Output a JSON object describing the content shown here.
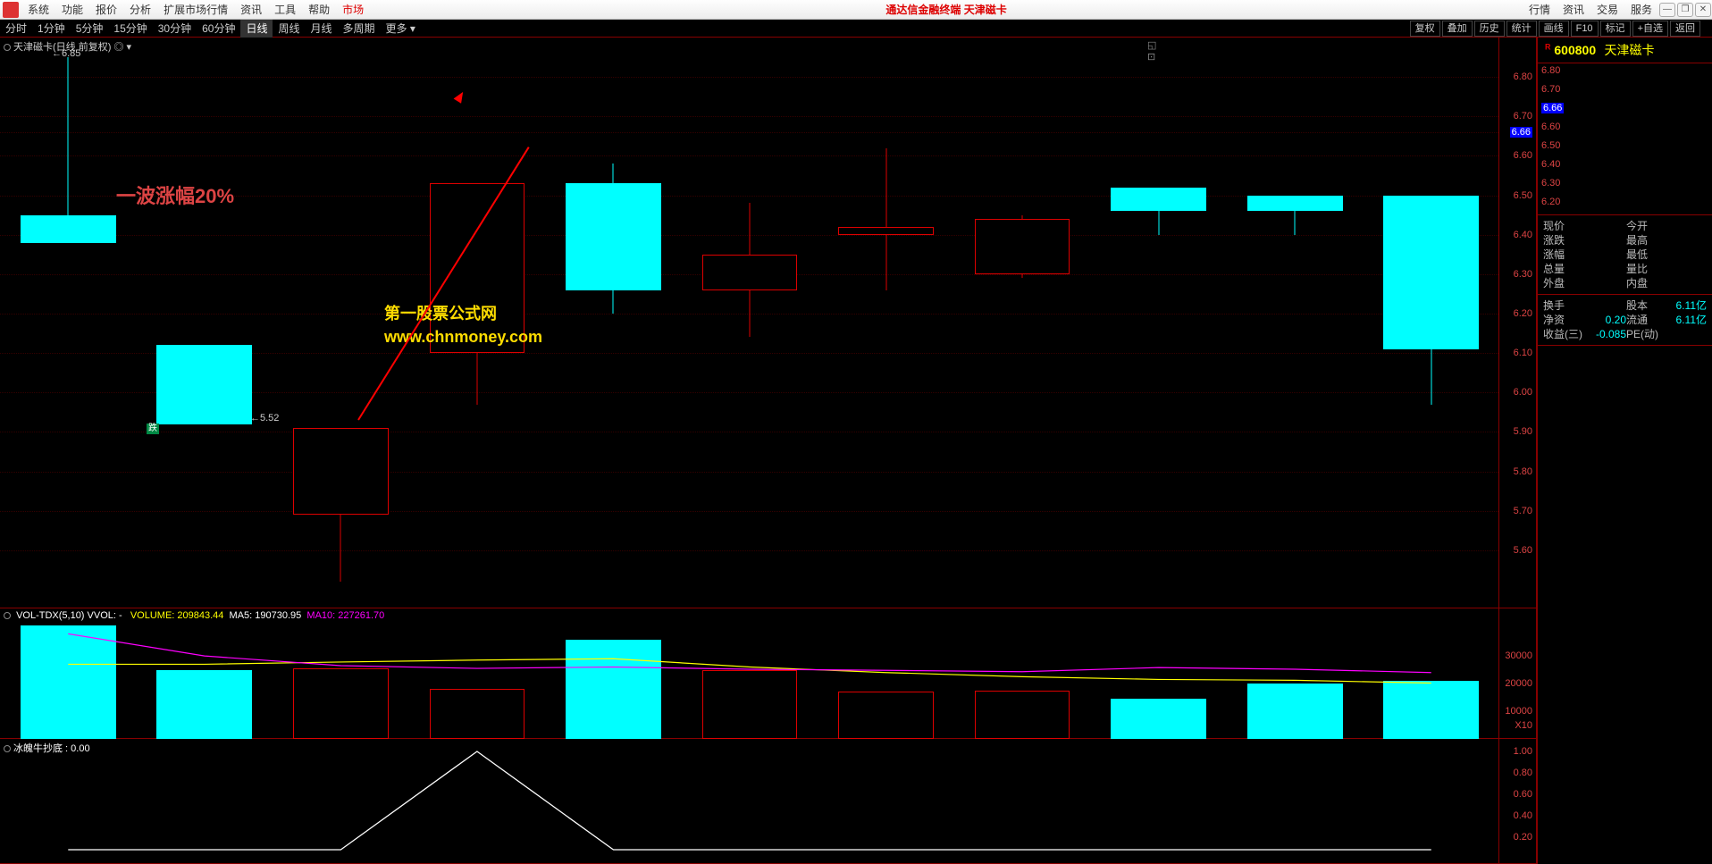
{
  "app": {
    "title_center": "通达信金融终端  天津磁卡"
  },
  "menubar": {
    "items": [
      "系统",
      "功能",
      "报价",
      "分析",
      "扩展市场行情",
      "资讯",
      "工具",
      "帮助"
    ],
    "market": "市场",
    "right": [
      "行情",
      "资讯",
      "交易",
      "服务"
    ]
  },
  "timebar": {
    "frames": [
      "分时",
      "1分钟",
      "5分钟",
      "15分钟",
      "30分钟",
      "60分钟",
      "日线",
      "周线",
      "月线",
      "多周期",
      "更多 ▾"
    ],
    "active": 6,
    "tools": [
      "复权",
      "叠加",
      "历史",
      "统计",
      "画线",
      "F10",
      "标记",
      "+自选",
      "返回"
    ]
  },
  "stock": {
    "code": "600800",
    "name": "天津磁卡",
    "sup": "R"
  },
  "candle_header": "天津磁卡(日线 前复权) ◎ ▾",
  "price_yaxis": [
    "6.80",
    "6.70",
    "6.66",
    "6.60",
    "6.50",
    "6.40",
    "6.30",
    "6.20",
    "6.10",
    "6.00",
    "5.90",
    "5.80",
    "5.70",
    "5.60"
  ],
  "price_hl_value": "6.66",
  "annotations": {
    "wave_text": "一波涨幅20%",
    "site_name": "第一股票公式网",
    "site_url": "www.chnmoney.com",
    "tag_high": "6.85",
    "tag_low": "5.52",
    "marker": "跌"
  },
  "chart_data": {
    "type": "candlestick",
    "ylim": [
      5.5,
      6.9
    ],
    "candles": [
      {
        "o": 6.45,
        "h": 6.85,
        "l": 6.38,
        "c": 6.38,
        "dir": "down"
      },
      {
        "o": 6.12,
        "h": 6.12,
        "l": 5.92,
        "c": 5.92,
        "dir": "down"
      },
      {
        "o": 5.91,
        "h": 5.91,
        "l": 5.52,
        "c": 5.69,
        "dir": "up"
      },
      {
        "o": 6.1,
        "h": 6.53,
        "l": 5.97,
        "c": 6.53,
        "dir": "up"
      },
      {
        "o": 6.53,
        "h": 6.58,
        "l": 6.2,
        "c": 6.26,
        "dir": "down"
      },
      {
        "o": 6.35,
        "h": 6.48,
        "l": 6.14,
        "c": 6.26,
        "dir": "up"
      },
      {
        "o": 6.42,
        "h": 6.62,
        "l": 6.26,
        "c": 6.4,
        "dir": "up"
      },
      {
        "o": 6.3,
        "h": 6.45,
        "l": 6.29,
        "c": 6.44,
        "dir": "up"
      },
      {
        "o": 6.46,
        "h": 6.52,
        "l": 6.4,
        "c": 6.52,
        "dir": "down"
      },
      {
        "o": 6.46,
        "h": 6.5,
        "l": 6.4,
        "c": 6.5,
        "dir": "down"
      },
      {
        "o": 6.5,
        "h": 6.5,
        "l": 5.97,
        "c": 6.11,
        "dir": "down"
      }
    ]
  },
  "volume": {
    "header_prefix": "VOL-TDX(5,10)  VVOL: -",
    "header_vol_label": "VOLUME:",
    "header_vol": "209843.44",
    "header_ma5_label": "MA5:",
    "header_ma5": "190730.95",
    "header_ma10_label": "MA10:",
    "header_ma10": "227261.70",
    "yaxis": [
      "30000",
      "20000",
      "10000",
      "X10"
    ],
    "bars": [
      {
        "v": 41000,
        "dir": "down"
      },
      {
        "v": 25000,
        "dir": "down"
      },
      {
        "v": 25500,
        "dir": "up"
      },
      {
        "v": 18000,
        "dir": "up"
      },
      {
        "v": 36000,
        "dir": "down"
      },
      {
        "v": 25000,
        "dir": "up"
      },
      {
        "v": 17000,
        "dir": "up"
      },
      {
        "v": 17500,
        "dir": "up"
      },
      {
        "v": 14500,
        "dir": "down"
      },
      {
        "v": 20000,
        "dir": "down"
      },
      {
        "v": 21000,
        "dir": "down"
      }
    ],
    "ma5": [
      27000,
      27000,
      27800,
      28500,
      29000,
      26000,
      24000,
      22500,
      21500,
      21200,
      20200
    ],
    "ma10": [
      38000,
      30000,
      26500,
      25500,
      26000,
      25200,
      24800,
      24300,
      25800,
      25200,
      24000
    ]
  },
  "indicator": {
    "header": "冰魄牛抄底 : 0.00",
    "yaxis": [
      "1.00",
      "0.80",
      "0.60",
      "0.40",
      "0.20"
    ],
    "line": [
      0,
      0,
      0,
      1,
      0,
      0,
      0,
      0,
      0,
      0,
      0
    ]
  },
  "side_info": {
    "rows1": [
      {
        "l1": "现价",
        "v1": "",
        "l2": "今开",
        "v2": ""
      },
      {
        "l1": "涨跌",
        "v1": "",
        "l2": "最高",
        "v2": ""
      },
      {
        "l1": "涨幅",
        "v1": "",
        "l2": "最低",
        "v2": ""
      },
      {
        "l1": "总量",
        "v1": "",
        "l2": "量比",
        "v2": ""
      },
      {
        "l1": "外盘",
        "v1": "",
        "l2": "内盘",
        "v2": ""
      }
    ],
    "rows2": [
      {
        "l1": "换手",
        "v1": "",
        "l2": "股本",
        "v2": "6.11亿"
      },
      {
        "l1": "净资",
        "v1": "0.20",
        "l2": "流通",
        "v2": "6.11亿"
      },
      {
        "l1": "收益(三)",
        "v1": "-0.085",
        "l2": "PE(动)",
        "v2": ""
      }
    ]
  }
}
